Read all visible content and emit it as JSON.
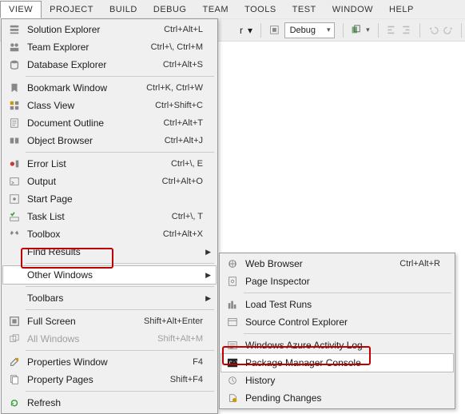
{
  "menubar": [
    "VIEW",
    "PROJECT",
    "BUILD",
    "DEBUG",
    "TEAM",
    "TOOLS",
    "TEST",
    "WINDOW",
    "HELP"
  ],
  "toolbar": {
    "dropdown_r_suffix": "r",
    "configuration": "Debug"
  },
  "view_menu": {
    "groups": [
      [
        {
          "icon": "solution",
          "label": "Solution Explorer",
          "shortcut": "Ctrl+Alt+L"
        },
        {
          "icon": "team",
          "label": "Team Explorer",
          "shortcut": "Ctrl+\\, Ctrl+M"
        },
        {
          "icon": "db",
          "label": "Database Explorer",
          "shortcut": "Ctrl+Alt+S"
        }
      ],
      [
        {
          "icon": "bookmark",
          "label": "Bookmark Window",
          "shortcut": "Ctrl+K, Ctrl+W"
        },
        {
          "icon": "class",
          "label": "Class View",
          "shortcut": "Ctrl+Shift+C"
        },
        {
          "icon": "doc",
          "label": "Document Outline",
          "shortcut": "Ctrl+Alt+T"
        },
        {
          "icon": "object",
          "label": "Object Browser",
          "shortcut": "Ctrl+Alt+J"
        }
      ],
      [
        {
          "icon": "error",
          "label": "Error List",
          "shortcut": "Ctrl+\\, E"
        },
        {
          "icon": "output",
          "label": "Output",
          "shortcut": "Ctrl+Alt+O"
        },
        {
          "icon": "start",
          "label": "Start Page",
          "shortcut": ""
        },
        {
          "icon": "task",
          "label": "Task List",
          "shortcut": "Ctrl+\\, T"
        },
        {
          "icon": "toolbox",
          "label": "Toolbox",
          "shortcut": "Ctrl+Alt+X"
        },
        {
          "icon": "",
          "label": "Find Results",
          "shortcut": "",
          "submenu": true
        }
      ],
      [
        {
          "icon": "",
          "label": "Other Windows",
          "shortcut": "",
          "submenu": true,
          "hover": true
        }
      ],
      [
        {
          "icon": "",
          "label": "Toolbars",
          "shortcut": "",
          "submenu": true
        }
      ],
      [
        {
          "icon": "fullscreen",
          "label": "Full Screen",
          "shortcut": "Shift+Alt+Enter"
        },
        {
          "icon": "allwin",
          "label": "All Windows",
          "shortcut": "Shift+Alt+M",
          "disabled": true
        }
      ],
      [
        {
          "icon": "props",
          "label": "Properties Window",
          "shortcut": "F4"
        },
        {
          "icon": "pages",
          "label": "Property Pages",
          "shortcut": "Shift+F4"
        }
      ],
      [
        {
          "icon": "refresh",
          "label": "Refresh",
          "shortcut": ""
        }
      ]
    ]
  },
  "sub_menu": {
    "items": [
      {
        "icon": "web",
        "label": "Web Browser",
        "shortcut": "Ctrl+Alt+R"
      },
      {
        "icon": "page",
        "label": "Page Inspector",
        "shortcut": ""
      },
      {
        "sep": true
      },
      {
        "icon": "load",
        "label": "Load Test Runs",
        "shortcut": ""
      },
      {
        "icon": "src",
        "label": "Source Control Explorer",
        "shortcut": ""
      },
      {
        "sep": true
      },
      {
        "icon": "azure",
        "label": "Windows Azure Activity Log",
        "shortcut": ""
      },
      {
        "icon": "pmc",
        "label": "Package Manager Console",
        "shortcut": "",
        "hover": true
      },
      {
        "icon": "history",
        "label": "History",
        "shortcut": ""
      },
      {
        "icon": "pending",
        "label": "Pending Changes",
        "shortcut": ""
      }
    ]
  },
  "highlight_labels": {
    "other_windows": "Other Windows",
    "pmc": "Package Manager Console"
  }
}
